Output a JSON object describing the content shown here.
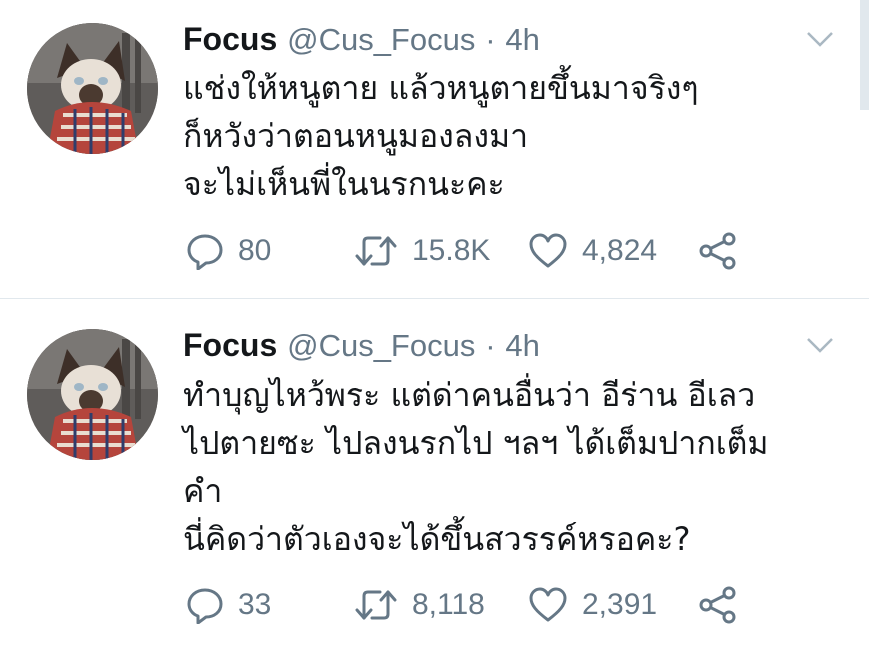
{
  "tweets": [
    {
      "name": "Focus",
      "handle": "@Cus_Focus",
      "separator": "·",
      "time": "4h",
      "lines": [
        "แช่งให้หนูตาย แล้วหนูตายขึ้นมาจริงๆ",
        "ก็หวังว่าตอนหนูมองลงมา",
        "จะไม่เห็นพี่ในนรกนะคะ"
      ],
      "replies": "80",
      "retweets": "15.8K",
      "likes": "4,824"
    },
    {
      "name": "Focus",
      "handle": "@Cus_Focus",
      "separator": "·",
      "time": "4h",
      "lines": [
        "ทำบุญไหว้พระ แต่ด่าคนอื่นว่า อีร่าน อีเลว",
        "ไปตายซะ ไปลงนรกไป ฯลฯ ได้เต็มปากเต็ม",
        "คำ",
        "นี่คิดว่าตัวเองจะได้ขึ้นสวรรค์หรอคะ?"
      ],
      "replies": "33",
      "retweets": "8,118",
      "likes": "2,391"
    }
  ],
  "icons": {
    "reply": "speech-bubble-icon",
    "retweet": "retweet-arrows-icon",
    "like": "heart-icon",
    "share": "share-icon",
    "menu": "chevron-down-icon"
  },
  "colors": {
    "text": "#14171a",
    "secondary": "#657786",
    "divider": "#e1e8ed"
  }
}
